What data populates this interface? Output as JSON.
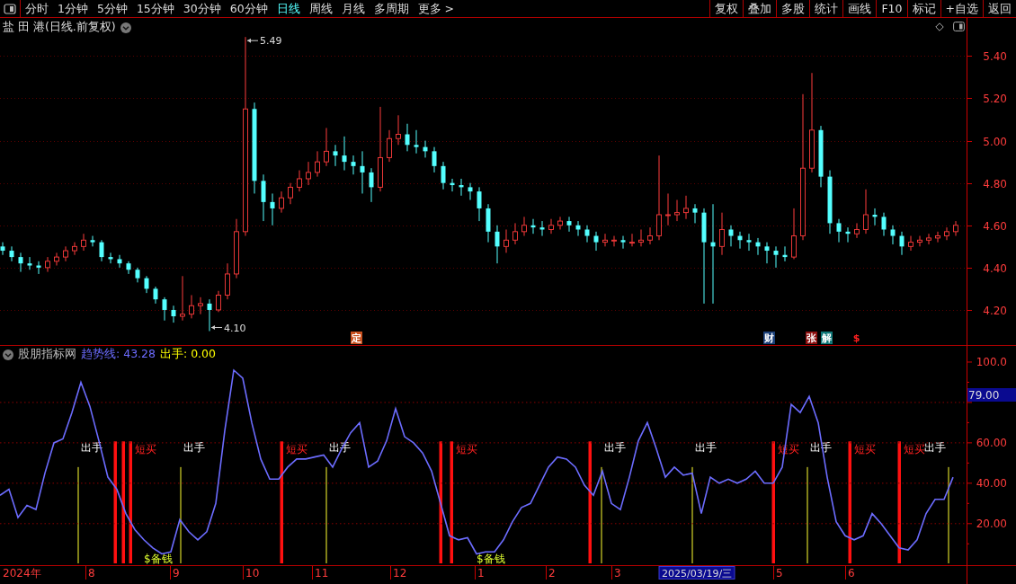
{
  "toolbar": {
    "period_tabs": [
      {
        "label": "分时",
        "selected": false
      },
      {
        "label": "1分钟",
        "selected": false
      },
      {
        "label": "5分钟",
        "selected": false
      },
      {
        "label": "15分钟",
        "selected": false
      },
      {
        "label": "30分钟",
        "selected": false
      },
      {
        "label": "60分钟",
        "selected": false
      },
      {
        "label": "日线",
        "selected": true
      },
      {
        "label": "周线",
        "selected": false
      },
      {
        "label": "月线",
        "selected": false
      },
      {
        "label": "多周期",
        "selected": false
      },
      {
        "label": "更多 >",
        "selected": false
      }
    ],
    "actions": [
      "复权",
      "叠加",
      "多股",
      "统计",
      "画线",
      "F10",
      "标记",
      "+自选",
      "返回"
    ]
  },
  "price_panel": {
    "title": "盐 田 港(日线.前复权)",
    "high_label": "5.49",
    "low_label": "4.10",
    "event_markers": [
      {
        "label": "定",
        "kind": "badge",
        "color": "#c8501e"
      },
      {
        "label": "财",
        "kind": "badge",
        "color": "#1a3f78"
      },
      {
        "label": "张",
        "kind": "badge",
        "color": "#8c1010"
      },
      {
        "label": "解",
        "kind": "badge",
        "color": "#107878"
      },
      {
        "label": "$",
        "kind": "glyph",
        "color": "#ff2020"
      }
    ],
    "chart_data": {
      "type": "candlestick",
      "ylim": [
        4.03,
        5.58
      ],
      "yticks": [
        {
          "value": 5.4,
          "label": "5.40"
        },
        {
          "value": 5.2,
          "label": "5.20"
        },
        {
          "value": 5.0,
          "label": "5.00"
        },
        {
          "value": 4.8,
          "label": "4.80"
        },
        {
          "value": 4.6,
          "label": "4.60"
        },
        {
          "value": 4.4,
          "label": "4.40"
        },
        {
          "value": 4.2,
          "label": "4.20"
        }
      ],
      "grid": true,
      "ohlc": [
        [
          4.5,
          4.52,
          4.46,
          4.48
        ],
        [
          4.48,
          4.5,
          4.43,
          4.45
        ],
        [
          4.45,
          4.47,
          4.38,
          4.42
        ],
        [
          4.42,
          4.45,
          4.39,
          4.41
        ],
        [
          4.41,
          4.43,
          4.37,
          4.4
        ],
        [
          4.4,
          4.45,
          4.38,
          4.43
        ],
        [
          4.43,
          4.47,
          4.41,
          4.45
        ],
        [
          4.45,
          4.5,
          4.43,
          4.48
        ],
        [
          4.48,
          4.52,
          4.46,
          4.5
        ],
        [
          4.5,
          4.56,
          4.48,
          4.53
        ],
        [
          4.53,
          4.55,
          4.5,
          4.52
        ],
        [
          4.52,
          4.53,
          4.43,
          4.45
        ],
        [
          4.45,
          4.47,
          4.42,
          4.44
        ],
        [
          4.44,
          4.46,
          4.4,
          4.42
        ],
        [
          4.42,
          4.43,
          4.37,
          4.39
        ],
        [
          4.39,
          4.4,
          4.33,
          4.35
        ],
        [
          4.35,
          4.36,
          4.28,
          4.3
        ],
        [
          4.3,
          4.31,
          4.23,
          4.25
        ],
        [
          4.25,
          4.26,
          4.15,
          4.2
        ],
        [
          4.2,
          4.22,
          4.14,
          4.17
        ],
        [
          4.17,
          4.36,
          4.15,
          4.18
        ],
        [
          4.18,
          4.27,
          4.16,
          4.22
        ],
        [
          4.22,
          4.26,
          4.18,
          4.23
        ],
        [
          4.23,
          4.25,
          4.1,
          4.2
        ],
        [
          4.2,
          4.29,
          4.19,
          4.27
        ],
        [
          4.27,
          4.42,
          4.25,
          4.37
        ],
        [
          4.37,
          4.63,
          4.35,
          4.57
        ],
        [
          4.57,
          5.49,
          4.55,
          5.15
        ],
        [
          5.15,
          5.18,
          4.75,
          4.81
        ],
        [
          4.81,
          4.84,
          4.62,
          4.71
        ],
        [
          4.71,
          4.75,
          4.6,
          4.68
        ],
        [
          4.68,
          4.76,
          4.66,
          4.73
        ],
        [
          4.73,
          4.8,
          4.7,
          4.78
        ],
        [
          4.78,
          4.86,
          4.76,
          4.82
        ],
        [
          4.82,
          4.9,
          4.79,
          4.85
        ],
        [
          4.85,
          4.95,
          4.83,
          4.9
        ],
        [
          4.9,
          5.06,
          4.88,
          4.95
        ],
        [
          4.95,
          4.98,
          4.88,
          4.93
        ],
        [
          4.93,
          5.02,
          4.86,
          4.9
        ],
        [
          4.9,
          4.93,
          4.84,
          4.88
        ],
        [
          4.88,
          4.95,
          4.75,
          4.85
        ],
        [
          4.85,
          4.87,
          4.71,
          4.78
        ],
        [
          4.78,
          5.16,
          4.76,
          4.92
        ],
        [
          4.92,
          5.05,
          4.9,
          5.01
        ],
        [
          5.01,
          5.12,
          4.98,
          5.03
        ],
        [
          5.03,
          5.08,
          4.95,
          4.98
        ],
        [
          4.98,
          5.05,
          4.94,
          4.97
        ],
        [
          4.97,
          5.0,
          4.92,
          4.95
        ],
        [
          4.95,
          4.97,
          4.85,
          4.88
        ],
        [
          4.88,
          4.9,
          4.77,
          4.8
        ],
        [
          4.8,
          4.82,
          4.76,
          4.79
        ],
        [
          4.79,
          4.82,
          4.74,
          4.78
        ],
        [
          4.78,
          4.8,
          4.72,
          4.76
        ],
        [
          4.76,
          4.78,
          4.62,
          4.68
        ],
        [
          4.68,
          4.7,
          4.52,
          4.57
        ],
        [
          4.57,
          4.6,
          4.42,
          4.5
        ],
        [
          4.5,
          4.58,
          4.47,
          4.53
        ],
        [
          4.53,
          4.61,
          4.51,
          4.57
        ],
        [
          4.57,
          4.64,
          4.55,
          4.6
        ],
        [
          4.6,
          4.63,
          4.56,
          4.59
        ],
        [
          4.59,
          4.62,
          4.55,
          4.58
        ],
        [
          4.58,
          4.63,
          4.56,
          4.6
        ],
        [
          4.6,
          4.64,
          4.58,
          4.62
        ],
        [
          4.62,
          4.64,
          4.57,
          4.6
        ],
        [
          4.6,
          4.62,
          4.55,
          4.58
        ],
        [
          4.58,
          4.6,
          4.52,
          4.55
        ],
        [
          4.55,
          4.57,
          4.48,
          4.52
        ],
        [
          4.52,
          4.56,
          4.5,
          4.53
        ],
        [
          4.53,
          4.55,
          4.5,
          4.53
        ],
        [
          4.53,
          4.55,
          4.49,
          4.52
        ],
        [
          4.52,
          4.56,
          4.5,
          4.52
        ],
        [
          4.52,
          4.58,
          4.5,
          4.53
        ],
        [
          4.53,
          4.59,
          4.51,
          4.55
        ],
        [
          4.55,
          4.93,
          4.53,
          4.65
        ],
        [
          4.65,
          4.75,
          4.6,
          4.65
        ],
        [
          4.65,
          4.72,
          4.62,
          4.66
        ],
        [
          4.66,
          4.74,
          4.63,
          4.68
        ],
        [
          4.68,
          4.7,
          4.61,
          4.66
        ],
        [
          4.66,
          4.68,
          4.23,
          4.52
        ],
        [
          4.52,
          4.7,
          4.23,
          4.5
        ],
        [
          4.5,
          4.66,
          4.46,
          4.58
        ],
        [
          4.58,
          4.6,
          4.5,
          4.55
        ],
        [
          4.55,
          4.57,
          4.49,
          4.53
        ],
        [
          4.53,
          4.56,
          4.48,
          4.52
        ],
        [
          4.52,
          4.54,
          4.46,
          4.5
        ],
        [
          4.5,
          4.52,
          4.42,
          4.48
        ],
        [
          4.48,
          4.5,
          4.4,
          4.46
        ],
        [
          4.46,
          4.5,
          4.43,
          4.45
        ],
        [
          4.45,
          4.68,
          4.44,
          4.55
        ],
        [
          4.55,
          5.22,
          4.53,
          4.87
        ],
        [
          4.87,
          5.32,
          4.85,
          5.05
        ],
        [
          5.05,
          5.07,
          4.78,
          4.83
        ],
        [
          4.83,
          4.86,
          4.56,
          4.61
        ],
        [
          4.61,
          4.63,
          4.52,
          4.57
        ],
        [
          4.57,
          4.59,
          4.52,
          4.56
        ],
        [
          4.56,
          4.61,
          4.54,
          4.58
        ],
        [
          4.58,
          4.77,
          4.56,
          4.65
        ],
        [
          4.65,
          4.68,
          4.6,
          4.64
        ],
        [
          4.64,
          4.66,
          4.55,
          4.58
        ],
        [
          4.58,
          4.6,
          4.51,
          4.55
        ],
        [
          4.55,
          4.57,
          4.46,
          4.5
        ],
        [
          4.5,
          4.55,
          4.48,
          4.52
        ],
        [
          4.52,
          4.55,
          4.5,
          4.53
        ],
        [
          4.53,
          4.56,
          4.51,
          4.54
        ],
        [
          4.54,
          4.57,
          4.52,
          4.55
        ],
        [
          4.55,
          4.59,
          4.53,
          4.57
        ],
        [
          4.57,
          4.62,
          4.55,
          4.6
        ]
      ]
    }
  },
  "indicator_panel": {
    "name": "股朋指标网",
    "readouts": [
      {
        "text": "趋势线: 43.28",
        "color": "#6c6cff"
      },
      {
        "text": "出手: 0.00",
        "color": "#ffff00"
      }
    ],
    "cursor_value": "79.00",
    "chart_data": {
      "type": "line",
      "ylim": [
        -1,
        108
      ],
      "grid": true,
      "yticks": [
        {
          "value": 20,
          "label": "20.00"
        },
        {
          "value": 40,
          "label": "40.00"
        },
        {
          "value": 60,
          "label": "60.00"
        },
        {
          "value": 100,
          "label": "100.0"
        }
      ],
      "series": [
        {
          "color": "#6c6cff",
          "values": [
            34,
            37,
            23,
            29,
            27,
            45,
            60,
            62,
            75,
            90,
            78,
            61,
            43,
            37,
            25,
            17,
            12,
            8,
            5,
            6,
            22,
            16,
            12,
            16,
            30,
            66,
            96,
            92,
            70,
            52,
            42,
            42,
            48,
            52,
            52,
            53,
            54,
            48,
            57,
            65,
            70,
            48,
            51,
            61,
            77,
            63,
            60,
            55,
            46,
            30,
            14,
            12,
            13,
            5,
            6,
            6,
            12,
            21,
            28,
            30,
            39,
            48,
            53,
            52,
            48,
            39,
            34,
            46,
            30,
            27,
            43,
            61,
            70,
            57,
            43,
            48,
            44,
            45,
            25,
            43,
            40,
            42,
            40,
            42,
            46,
            40,
            40,
            48,
            79,
            75,
            83,
            70,
            43,
            21,
            14,
            12,
            14,
            25,
            20,
            14,
            8,
            7,
            12,
            25,
            32,
            32,
            43
          ]
        }
      ]
    },
    "signals": [
      {
        "kind": "exit",
        "label": "出手"
      },
      {
        "kind": "buy"
      },
      {
        "kind": "buy"
      },
      {
        "kind": "buy",
        "label": "短买"
      },
      {
        "kind": "cash",
        "label": "$备钱"
      },
      {
        "kind": "exit",
        "label": "出手"
      },
      {
        "kind": "buy",
        "label": "短买"
      },
      {
        "kind": "exit",
        "label": "出手"
      },
      {
        "kind": "buy"
      },
      {
        "kind": "buy",
        "label": "短买"
      },
      {
        "kind": "cash",
        "label": "$备钱"
      },
      {
        "kind": "buy"
      },
      {
        "kind": "exit",
        "label": "出手"
      },
      {
        "kind": "exit",
        "label": "出手"
      },
      {
        "kind": "buy",
        "label": "短买"
      },
      {
        "kind": "exit",
        "label": "出手"
      },
      {
        "kind": "buy",
        "label": "短买"
      },
      {
        "kind": "buy",
        "label": "短买"
      },
      {
        "kind": "exit",
        "label": "出手"
      }
    ]
  },
  "date_axis": {
    "labels": [
      "2024年",
      "8",
      "9",
      "10",
      "11",
      "12",
      "1",
      "2",
      "3",
      "5",
      "6"
    ],
    "cursor_date": "2025/03/19/三"
  }
}
